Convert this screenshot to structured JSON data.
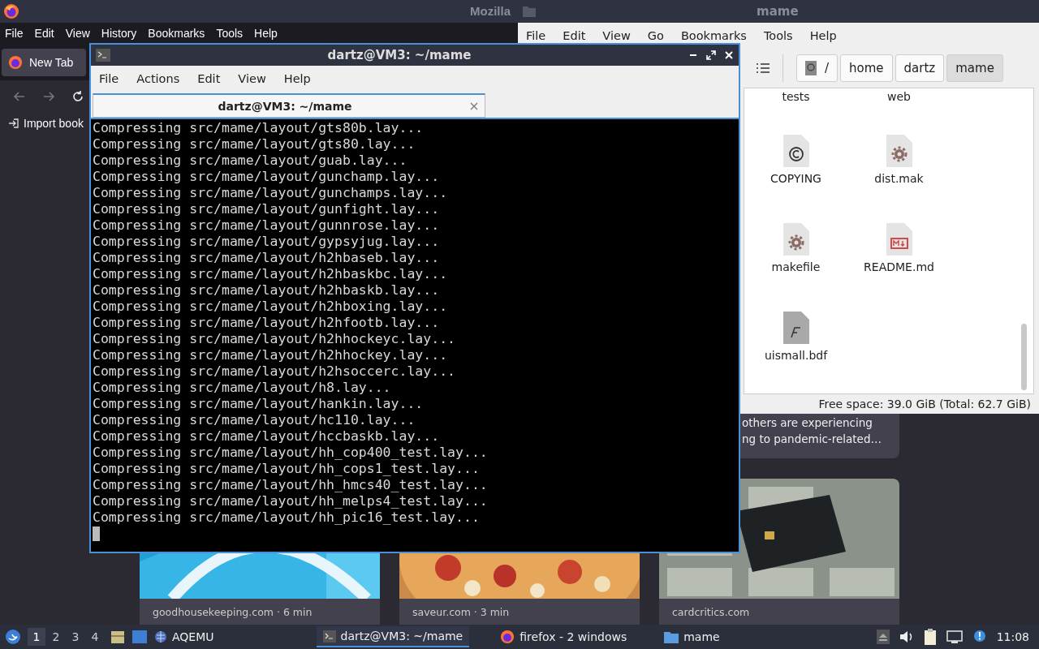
{
  "firefox": {
    "title": "Mozilla",
    "menu": [
      "File",
      "Edit",
      "View",
      "History",
      "Bookmarks",
      "Tools",
      "Help"
    ],
    "tab": {
      "label": "New Tab"
    },
    "bookmark": "Import book",
    "snippet": [
      "others are experiencing",
      "ng to pandemic-related…"
    ],
    "cards": [
      {
        "kind": "picture",
        "source": "goodhousekeeping.com · 6 min"
      },
      {
        "kind": "picture",
        "source": "saveur.com · 3 min"
      },
      {
        "kind": "picture",
        "source": "cardcritics.com"
      }
    ]
  },
  "file_manager": {
    "title": "mame",
    "menu": [
      "File",
      "Edit",
      "View",
      "Go",
      "Bookmarks",
      "Tools",
      "Help"
    ],
    "path": [
      {
        "label": "/",
        "selected": false
      },
      {
        "label": "home",
        "selected": false
      },
      {
        "label": "dartz",
        "selected": false
      },
      {
        "label": "mame",
        "selected": true
      }
    ],
    "items": [
      {
        "name": "tests",
        "kind": "folder"
      },
      {
        "name": "web",
        "kind": "folder"
      },
      {
        "name": "COPYING",
        "kind": "text"
      },
      {
        "name": "dist.mak",
        "kind": "config"
      },
      {
        "name": "makefile",
        "kind": "config"
      },
      {
        "name": "README.md",
        "kind": "markdown"
      },
      {
        "name": "uismall.bdf",
        "kind": "font"
      }
    ],
    "status": "Free space: 39.0 GiB (Total: 62.7 GiB)"
  },
  "terminal": {
    "title": "dartz@VM3: ~/mame",
    "menu": [
      "File",
      "Actions",
      "Edit",
      "View",
      "Help"
    ],
    "tab": {
      "title": "dartz@VM3: ~/mame"
    },
    "lines": [
      "Compressing src/mame/layout/gts80b.lay...",
      "Compressing src/mame/layout/gts80.lay...",
      "Compressing src/mame/layout/guab.lay...",
      "Compressing src/mame/layout/gunchamp.lay...",
      "Compressing src/mame/layout/gunchamps.lay...",
      "Compressing src/mame/layout/gunfight.lay...",
      "Compressing src/mame/layout/gunnrose.lay...",
      "Compressing src/mame/layout/gypsyjug.lay...",
      "Compressing src/mame/layout/h2hbaseb.lay...",
      "Compressing src/mame/layout/h2hbaskbc.lay...",
      "Compressing src/mame/layout/h2hbaskb.lay...",
      "Compressing src/mame/layout/h2hboxing.lay...",
      "Compressing src/mame/layout/h2hfootb.lay...",
      "Compressing src/mame/layout/h2hhockeyc.lay...",
      "Compressing src/mame/layout/h2hhockey.lay...",
      "Compressing src/mame/layout/h2hsoccerc.lay...",
      "Compressing src/mame/layout/h8.lay...",
      "Compressing src/mame/layout/hankin.lay...",
      "Compressing src/mame/layout/hc110.lay...",
      "Compressing src/mame/layout/hccbaskb.lay...",
      "Compressing src/mame/layout/hh_cop400_test.lay...",
      "Compressing src/mame/layout/hh_cops1_test.lay...",
      "Compressing src/mame/layout/hh_hmcs40_test.lay...",
      "Compressing src/mame/layout/hh_melps4_test.lay...",
      "Compressing src/mame/layout/hh_pic16_test.lay..."
    ]
  },
  "taskbar": {
    "workspaces": [
      {
        "label": "1",
        "selected": true
      },
      {
        "label": "2",
        "selected": false
      },
      {
        "label": "3",
        "selected": false
      },
      {
        "label": "4",
        "selected": false
      }
    ],
    "launcher": "AQEMU",
    "tasks": [
      {
        "label": "dartz@VM3: ~/mame",
        "kind": "terminal",
        "selected": true
      },
      {
        "label": "firefox - 2 windows",
        "kind": "browser",
        "selected": false
      },
      {
        "label": "mame",
        "kind": "folder",
        "selected": false
      }
    ],
    "clock": "11:08"
  }
}
